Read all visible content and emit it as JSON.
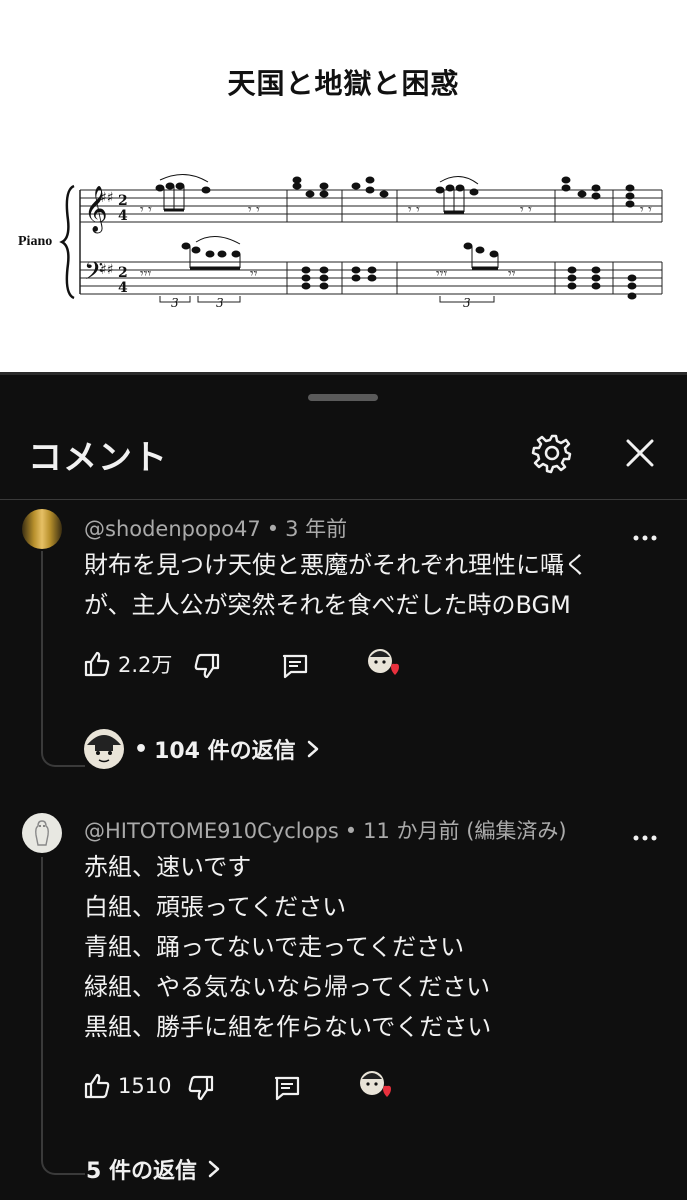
{
  "video": {
    "score_title": "天国と地獄と困惑",
    "instrument": "Piano",
    "triplet_mark": "3"
  },
  "sheet": {
    "title": "コメント",
    "settings_icon": "gear-icon",
    "close_icon": "close-icon"
  },
  "comments": [
    {
      "author": "@shodenpopo47",
      "time": "3 年前",
      "lines": [
        "財布を見つけ天使と悪魔がそれぞれ理性に囁く",
        "が、主人公が突然それを食べだした時のBGM"
      ],
      "likes": "2.2万",
      "replies_label": "104 件の返信",
      "replies_prefix": "•"
    },
    {
      "author": "@HITOTOME910Cyclops",
      "time": "11 か月前 (編集済み)",
      "lines": [
        "赤組、速いです",
        "白組、頑張ってください",
        "青組、踊ってないで走ってください",
        "緑組、やる気ないなら帰ってください",
        "黒組、勝手に組を作らないでください"
      ],
      "likes": "1510",
      "replies_label": "5 件の返信"
    }
  ],
  "colors": {
    "background": "#0f0f0f",
    "text": "#f1f1f1",
    "secondary_text": "#aaaaaa",
    "heart": "#e8303d"
  }
}
